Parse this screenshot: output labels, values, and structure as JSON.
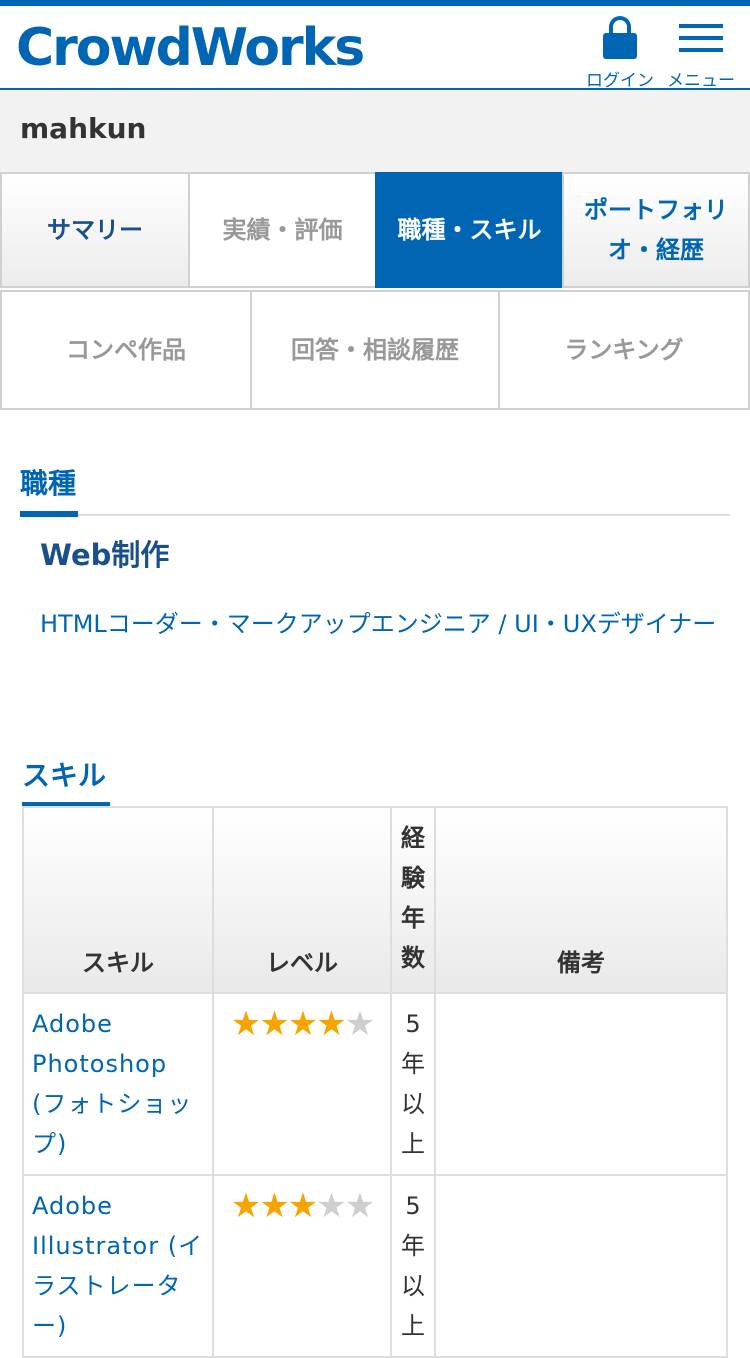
{
  "header": {
    "logo": "CrowdWorks",
    "login_label": "ログイン",
    "menu_label": "メニュー"
  },
  "user": {
    "name": "mahkun"
  },
  "tabs_row1": [
    {
      "label": "サマリー"
    },
    {
      "label": "実績・評価"
    },
    {
      "label": "職種・スキル",
      "active": true
    },
    {
      "label": "ポートフォリオ・経歴"
    }
  ],
  "tabs_row2": [
    {
      "label": "コンペ作品"
    },
    {
      "label": "回答・相談履歴"
    },
    {
      "label": "ランキング"
    }
  ],
  "occupation": {
    "title": "職種",
    "category": "Web制作",
    "jobs": "HTMLコーダー・マークアップエンジニア / UI・UXデザイナー"
  },
  "skills": {
    "title": "スキル",
    "headers": {
      "skill": "スキル",
      "level": "レベル",
      "years": "経験年数",
      "notes": "備考"
    },
    "rows": [
      {
        "name": "Adobe Photoshop (フォトショップ)",
        "level": 4,
        "max_level": 5,
        "years": "5年以上",
        "notes": ""
      },
      {
        "name": "Adobe Illustrator (イラストレーター)",
        "level": 3,
        "max_level": 5,
        "years": "5年以上",
        "notes": ""
      }
    ]
  },
  "colors": {
    "brand": "#0065b3",
    "star_on": "#f7a400",
    "star_off": "#cfcfcf"
  }
}
